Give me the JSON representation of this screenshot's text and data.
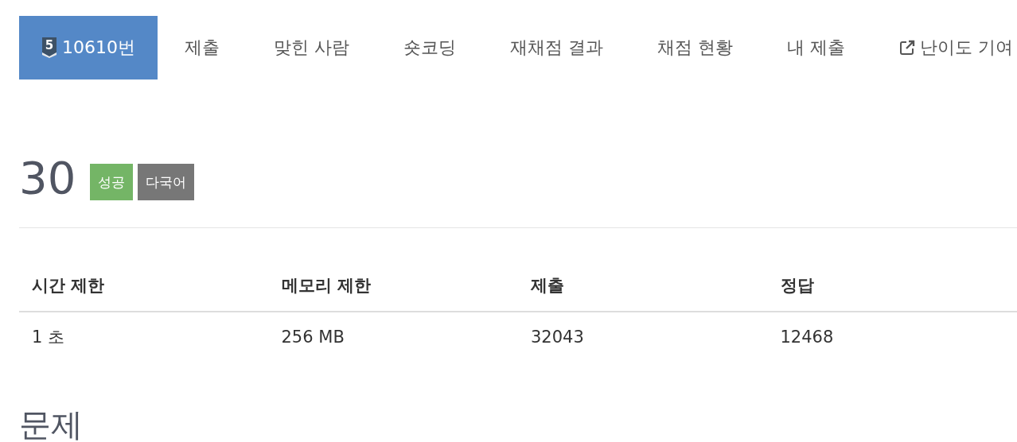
{
  "tabs": [
    {
      "label": "10610번",
      "selected": true,
      "kind": "problem",
      "tier": "5"
    },
    {
      "label": "제출",
      "selected": false,
      "kind": "plain"
    },
    {
      "label": "맞힌 사람",
      "selected": false,
      "kind": "plain"
    },
    {
      "label": "숏코딩",
      "selected": false,
      "kind": "plain"
    },
    {
      "label": "재채점 결과",
      "selected": false,
      "kind": "plain"
    },
    {
      "label": "채점 현황",
      "selected": false,
      "kind": "plain"
    },
    {
      "label": "내 제출",
      "selected": false,
      "kind": "plain"
    },
    {
      "label": "난이도 기여",
      "selected": false,
      "kind": "external"
    }
  ],
  "title": "30",
  "labels": [
    {
      "text": "성공",
      "color": "#74b566"
    },
    {
      "text": "다국어",
      "color": "#777777"
    }
  ],
  "table": {
    "columns": [
      "시간 제한",
      "메모리 제한",
      "제출",
      "정답"
    ],
    "rows": [
      [
        "1 초",
        "256 MB",
        "32043",
        "12468"
      ]
    ]
  },
  "section_heading": "문제"
}
